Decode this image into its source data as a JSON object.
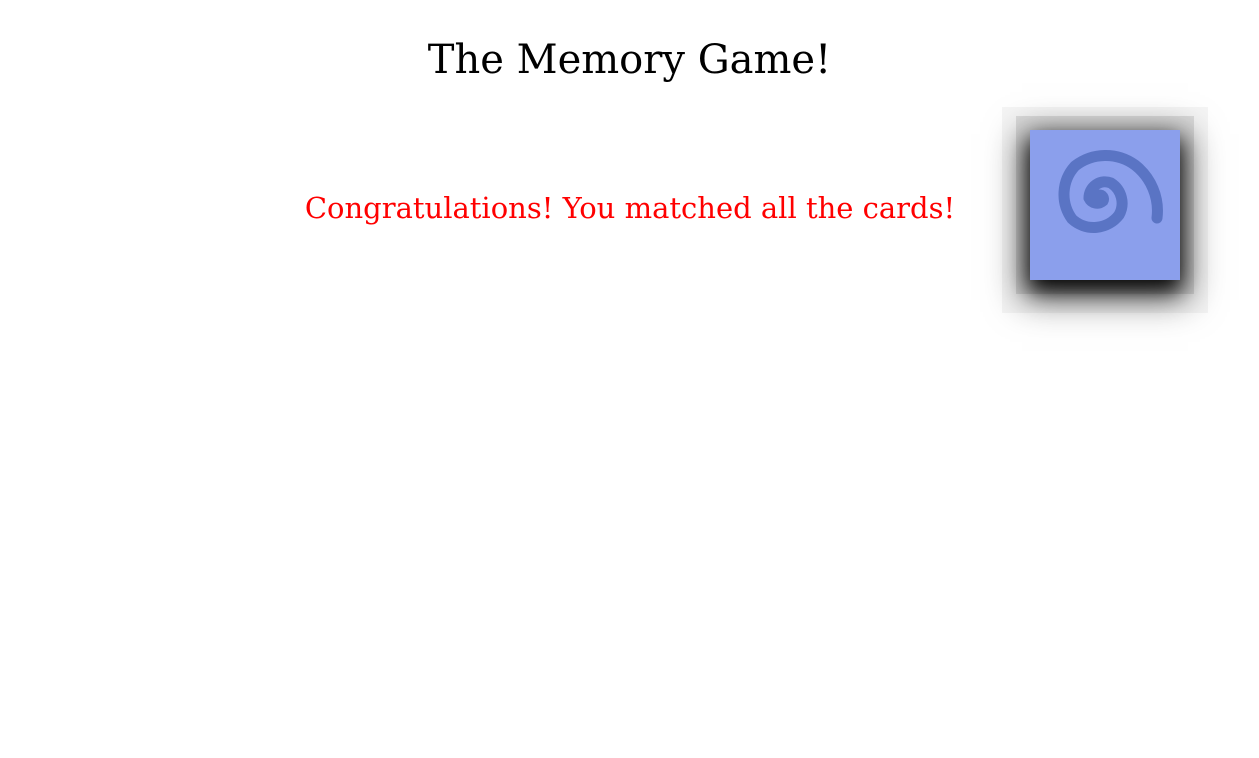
{
  "page": {
    "title": "The Memory Game!"
  },
  "status": {
    "message": "Congratulations! You matched all the cards!",
    "message_color": "#ff0000"
  },
  "card": {
    "icon": "spiral-icon",
    "face_color": "#8b9fec",
    "symbol_color": "#5a74c4"
  }
}
